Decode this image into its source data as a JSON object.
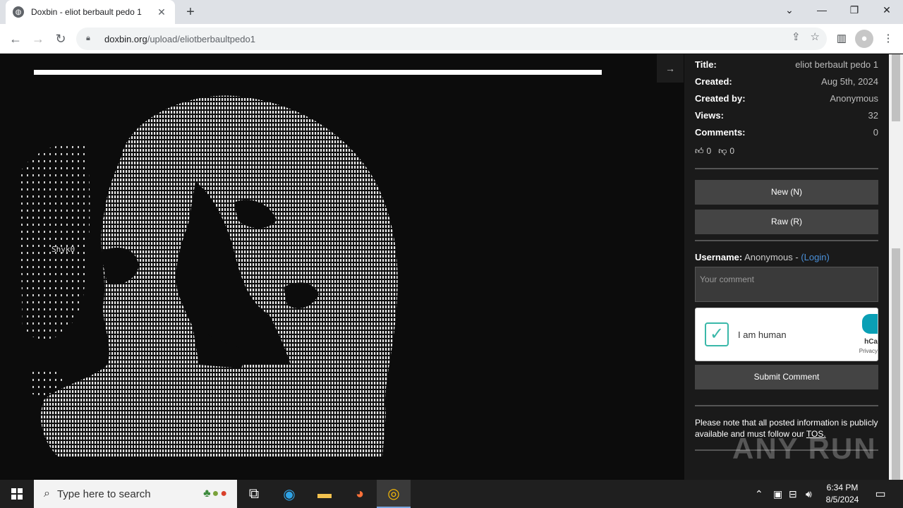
{
  "browser": {
    "tab_title": "Doxbin - eliot berbault pedo 1",
    "tab_close": "✕",
    "new_tab": "+",
    "url_host": "doxbin.org",
    "url_path": "/upload/eliotberbaultpedo1",
    "icons": [
      "back-icon",
      "forward-icon",
      "reload-icon",
      "lock-icon",
      "share-icon",
      "star-icon",
      "sidepanel-icon",
      "profile-icon",
      "menu-icon"
    ]
  },
  "page": {
    "art_caption": "Shyk0",
    "collapse_icon": "→"
  },
  "sidebar": {
    "meta": [
      {
        "label": "Title:",
        "value": "eliot berbault pedo 1"
      },
      {
        "label": "Created:",
        "value": "Aug 5th, 2024"
      },
      {
        "label": "Created by:",
        "value": "Anonymous"
      },
      {
        "label": "Views:",
        "value": "32"
      },
      {
        "label": "Comments:",
        "value": "0"
      }
    ],
    "likes": "0",
    "dislikes": "0",
    "new_button": "New (N)",
    "raw_button": "Raw (R)",
    "username_label": "Username:",
    "username_value": "Anonymous - ",
    "login_link": "(Login)",
    "comment_placeholder": "Your comment",
    "captcha_label": "I am human",
    "captcha_brand": "hCa",
    "captcha_privacy": "Privacy",
    "submit_button": "Submit Comment",
    "note_text": "Please note that all posted information is publicly available and must follow our ",
    "note_link": "TOS."
  },
  "watermark": "ANY RUN",
  "taskbar": {
    "search_placeholder": "Type here to search",
    "time": "6:34 PM",
    "date": "8/5/2024"
  }
}
